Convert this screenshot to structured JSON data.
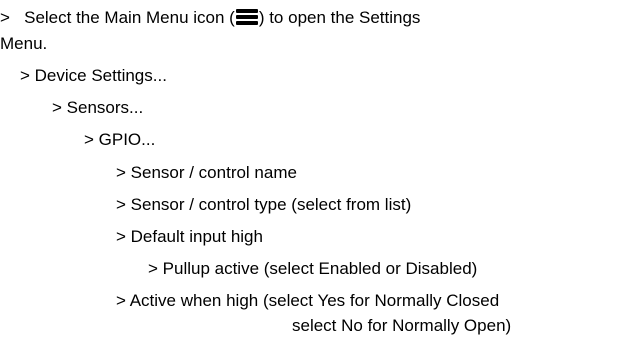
{
  "intro": {
    "marker": ">",
    "before_icon": "Select the Main Menu icon (",
    "icon": "hamburger-menu-icon",
    "after_icon": ") to open the Settings",
    "continuation": "Menu."
  },
  "steps": [
    {
      "level": 1,
      "text": "> Device Settings..."
    },
    {
      "level": 2,
      "text": "> Sensors..."
    },
    {
      "level": 3,
      "text": "> GPIO..."
    },
    {
      "level": 4,
      "text": "> Sensor / control name"
    },
    {
      "level": 4,
      "text": "> Sensor / control type (select from list)"
    },
    {
      "level": 4,
      "text": "> Default input high"
    },
    {
      "level": 5,
      "text": "> Pullup active (select Enabled or Disabled)"
    },
    {
      "level": 4,
      "text": "> Active when high (select Yes for Normally Closed"
    }
  ],
  "final_continuation": "select No for Normally Open)"
}
